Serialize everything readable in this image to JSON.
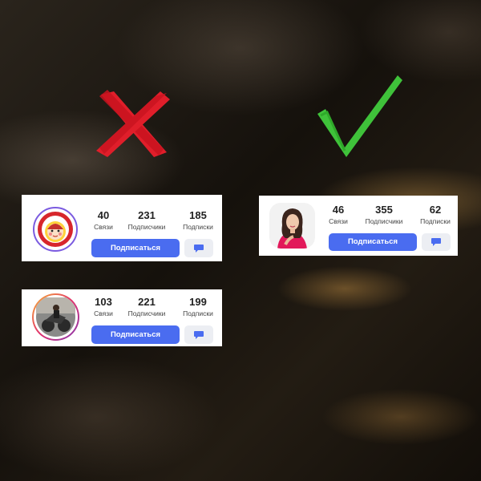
{
  "cards": [
    {
      "id": "card-1",
      "stats": [
        {
          "value": "40",
          "label": "Связи"
        },
        {
          "value": "231",
          "label": "Подписчики"
        },
        {
          "value": "185",
          "label": "Подписки"
        }
      ],
      "subscribe_label": "Подписаться",
      "message_icon": "chat-bubble-icon",
      "avatar_icon": "matryoshka-doll-icon"
    },
    {
      "id": "card-2",
      "stats": [
        {
          "value": "103",
          "label": "Связи"
        },
        {
          "value": "221",
          "label": "Подписчики"
        },
        {
          "value": "199",
          "label": "Подписки"
        }
      ],
      "subscribe_label": "Подписаться",
      "message_icon": "chat-bubble-icon",
      "avatar_icon": "motorcycle-photo"
    },
    {
      "id": "card-3",
      "stats": [
        {
          "value": "46",
          "label": "Связи"
        },
        {
          "value": "355",
          "label": "Подписчики"
        },
        {
          "value": "62",
          "label": "Подписки"
        }
      ],
      "subscribe_label": "Подписаться",
      "message_icon": "chat-bubble-icon",
      "avatar_icon": "woman-portrait-photo"
    }
  ],
  "marks": {
    "wrong": "red-cross-icon",
    "right": "green-check-icon"
  },
  "colors": {
    "accent": "#4a6cf0",
    "wrong": "#e01e2a",
    "right": "#3fc23a"
  }
}
